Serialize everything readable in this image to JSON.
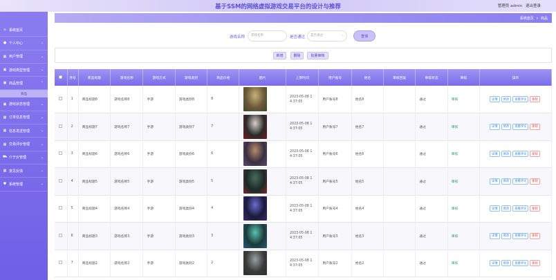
{
  "header": {
    "title": "基于SSM的网络虚拟游戏交易平台的设计与推荐",
    "user_label": "管理员 admin",
    "logout": "退出登录"
  },
  "sidebar": {
    "items": [
      {
        "label": "系统首页",
        "icon": "home-icon",
        "arrow": ""
      },
      {
        "label": "个人中心",
        "icon": "user-icon",
        "arrow": "⌄"
      },
      {
        "label": "用户管理",
        "icon": "grid-icon",
        "arrow": "⌄"
      },
      {
        "label": "游戏类型管理",
        "icon": "box-icon",
        "arrow": "⌄"
      },
      {
        "label": "商品管理",
        "icon": "box-icon",
        "arrow": "⌃"
      },
      {
        "label": "游戏状态管理",
        "icon": "box-icon",
        "arrow": "⌄"
      },
      {
        "label": "订单信息管理",
        "icon": "grid-icon",
        "arrow": "⌄"
      },
      {
        "label": "信息发送管理",
        "icon": "grid-icon",
        "arrow": "⌄"
      },
      {
        "label": "交易评价管理",
        "icon": "grid-icon",
        "arrow": "⌄"
      },
      {
        "label": "介于价管理",
        "icon": "cart-icon",
        "arrow": "⌄"
      },
      {
        "label": "意见反馈",
        "icon": "grid-icon",
        "arrow": "⌄"
      },
      {
        "label": "系统管理",
        "icon": "shield-icon",
        "arrow": "⌄"
      }
    ],
    "subitem": "商品"
  },
  "breadcrumb": {
    "home": "系统首页",
    "sep": "»",
    "current": "商品"
  },
  "search": {
    "name_label": "游戏名称",
    "name_placeholder": "游戏名称",
    "pass_label": "是否通过",
    "pass_placeholder": "是否通过",
    "button": "查询"
  },
  "actions": {
    "add": "新增",
    "delete": "删除",
    "batch": "批量审核"
  },
  "table": {
    "headers": [
      "",
      "序号",
      "商品标题",
      "游戏名称",
      "游戏方式",
      "游戏类别",
      "商品价格",
      "图片",
      "上架时间",
      "用户账号",
      "姓名",
      "审核回复",
      "审核状态",
      "审核",
      "操作"
    ],
    "ops": {
      "detail": "详情",
      "edit": "修改",
      "review": "查看评论",
      "delete": "删除"
    },
    "rows": [
      {
        "idx": "1",
        "title": "商品标题8",
        "game": "游戏名称8",
        "mode": "手游",
        "type": "游戏类别8",
        "price": "8",
        "date1": "2023-05-08 1",
        "date2": "4:37:05",
        "account": "用户账号8",
        "name": "姓名8",
        "reply": "",
        "status": "通过",
        "audit": "审核",
        "img": [
          "#6b5a3a",
          "#c9b07a",
          "#3a4a2a"
        ]
      },
      {
        "idx": "2",
        "title": "商品标题7",
        "game": "游戏名称7",
        "mode": "手游",
        "type": "游戏类别7",
        "price": "7",
        "date1": "2023-05-08 1",
        "date2": "4:37:05",
        "account": "用户账号7",
        "name": "姓名7",
        "reply": "",
        "status": "通过",
        "audit": "审核",
        "img": [
          "#2a2a2a",
          "#d8d0c8",
          "#7a1a1a"
        ]
      },
      {
        "idx": "3",
        "title": "商品标题6",
        "game": "游戏名称6",
        "mode": "手游",
        "type": "游戏类别6",
        "price": "6",
        "date1": "2023-05-08 1",
        "date2": "4:37:05",
        "account": "用户账号6",
        "name": "姓名6",
        "reply": "",
        "status": "通过",
        "audit": "审核",
        "img": [
          "#3a3040",
          "#b88a6a",
          "#5a4a6a"
        ]
      },
      {
        "idx": "4",
        "title": "商品标题5",
        "game": "游戏名称5",
        "mode": "手游",
        "type": "游戏类别5",
        "price": "5",
        "date1": "2023-05-08 1",
        "date2": "4:37:05",
        "account": "用户账号5",
        "name": "姓名5",
        "reply": "",
        "status": "通过",
        "audit": "审核",
        "img": [
          "#1a2a2a",
          "#4a6a5a",
          "#7a2a2a"
        ]
      },
      {
        "idx": "5",
        "title": "商品标题4",
        "game": "游戏名称4",
        "mode": "手游",
        "type": "游戏类别4",
        "price": "4",
        "date1": "2023-05-08 1",
        "date2": "4:37:05",
        "account": "用户账号4",
        "name": "姓名4",
        "reply": "",
        "status": "通过",
        "audit": "审核",
        "img": [
          "#1a1a3a",
          "#6a6ad0",
          "#3a2a6a"
        ]
      },
      {
        "idx": "6",
        "title": "商品标题3",
        "game": "游戏名称3",
        "mode": "手游",
        "type": "游戏类别3",
        "price": "3",
        "date1": "2023-05-08 1",
        "date2": "4:37:05",
        "account": "用户账号3",
        "name": "姓名3",
        "reply": "",
        "status": "通过",
        "audit": "审核",
        "img": [
          "#1a3a3a",
          "#5ac0b0",
          "#2a5a7a"
        ]
      },
      {
        "idx": "7",
        "title": "商品标题2",
        "game": "游戏名称2",
        "mode": "手游",
        "type": "游戏类别2",
        "price": "2",
        "date1": "2023-05-08 1",
        "date2": "4:37:05",
        "account": "用户账号2",
        "name": "姓名2",
        "reply": "",
        "status": "通过",
        "audit": "审核",
        "img": [
          "#3a3a3a",
          "#9aa0a0",
          "#2a3030"
        ]
      }
    ]
  },
  "colors": {
    "accent": "#7a6cea",
    "status_ok": "#2aa86a",
    "danger": "#e05050",
    "link": "#3a8ad8"
  }
}
